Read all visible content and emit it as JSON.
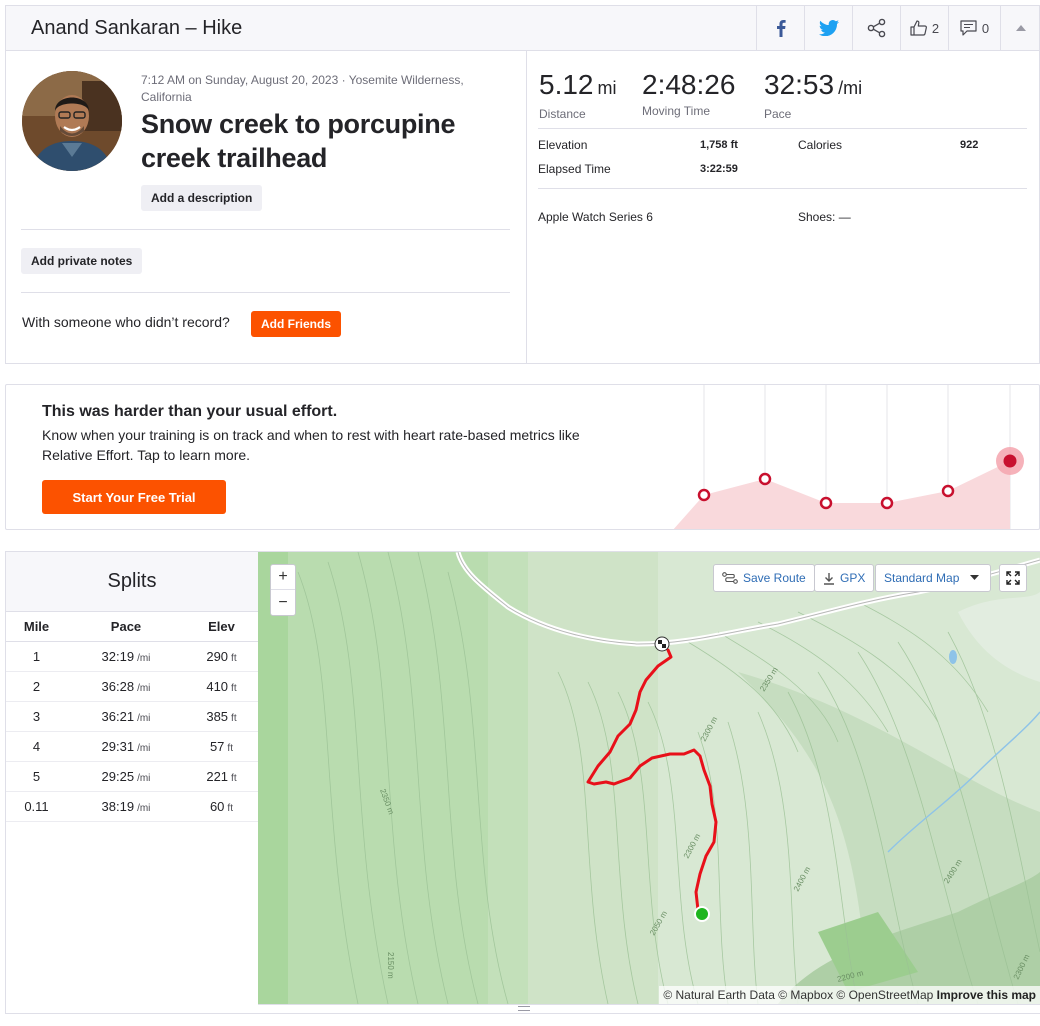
{
  "header": {
    "title": "Anand Sankaran – Hike",
    "kudos_count": "2",
    "comments_count": "0",
    "icons": [
      "facebook-icon",
      "twitter-icon",
      "share-icon",
      "thumbs-up-icon",
      "comment-icon",
      "chevron-up-icon"
    ]
  },
  "activity": {
    "meta": "7:12 AM on Sunday, August 20, 2023 · Yosemite Wilderness, California",
    "title": "Snow creek to porcupine creek trailhead",
    "add_description": "Add a description",
    "add_private_notes": "Add private notes",
    "with_someone": "With someone who didn’t record?",
    "add_friends": "Add Friends"
  },
  "stats": {
    "distance": {
      "value": "5.12",
      "unit": "mi",
      "label": "Distance"
    },
    "moving_time": {
      "value": "2:48:26",
      "label": "Moving Time"
    },
    "pace": {
      "value": "32:53",
      "unit": "/mi",
      "label": "Pace"
    },
    "elevation_label": "Elevation",
    "elevation_value": "1,758 ft",
    "calories_label": "Calories",
    "calories_value": "922",
    "elapsed_label": "Elapsed Time",
    "elapsed_value": "3:22:59",
    "device": "Apple Watch Series 6",
    "shoes": "Shoes: —"
  },
  "effort": {
    "heading": "This was harder than your usual effort.",
    "body": "Know when your training is on track and when to rest with heart rate-based metrics like Relative Effort. Tap to learn more.",
    "cta": "Start Your Free Trial"
  },
  "splits": {
    "title": "Splits",
    "columns": [
      "Mile",
      "Pace",
      "Elev"
    ],
    "pace_unit": "/mi",
    "elev_unit": "ft",
    "rows": [
      {
        "mile": "1",
        "pace": "32:19",
        "elev": "290"
      },
      {
        "mile": "2",
        "pace": "36:28",
        "elev": "410"
      },
      {
        "mile": "3",
        "pace": "36:21",
        "elev": "385"
      },
      {
        "mile": "4",
        "pace": "29:31",
        "elev": "57"
      },
      {
        "mile": "5",
        "pace": "29:25",
        "elev": "221"
      },
      {
        "mile": "0.11",
        "pace": "38:19",
        "elev": "60"
      }
    ]
  },
  "map": {
    "zoom_in": "+",
    "zoom_out": "−",
    "save_route": "Save Route",
    "gpx": "GPX",
    "map_type": "Standard Map",
    "attribution": "© Natural Earth Data © Mapbox © OpenStreetMap",
    "improve": "Improve this map",
    "contour_labels": [
      "2350 m",
      "2300 m",
      "2350 m",
      "2300 m",
      "2400 m",
      "2400 m",
      "2050 m",
      "2150 m",
      "2200 m",
      "2300 m"
    ],
    "route_color": "#e8101a",
    "start_color": "#1fb51f"
  },
  "colors": {
    "brand": "#fc5200",
    "effort_marker": "#c8102e",
    "effort_fill": "#f9d9dc"
  }
}
